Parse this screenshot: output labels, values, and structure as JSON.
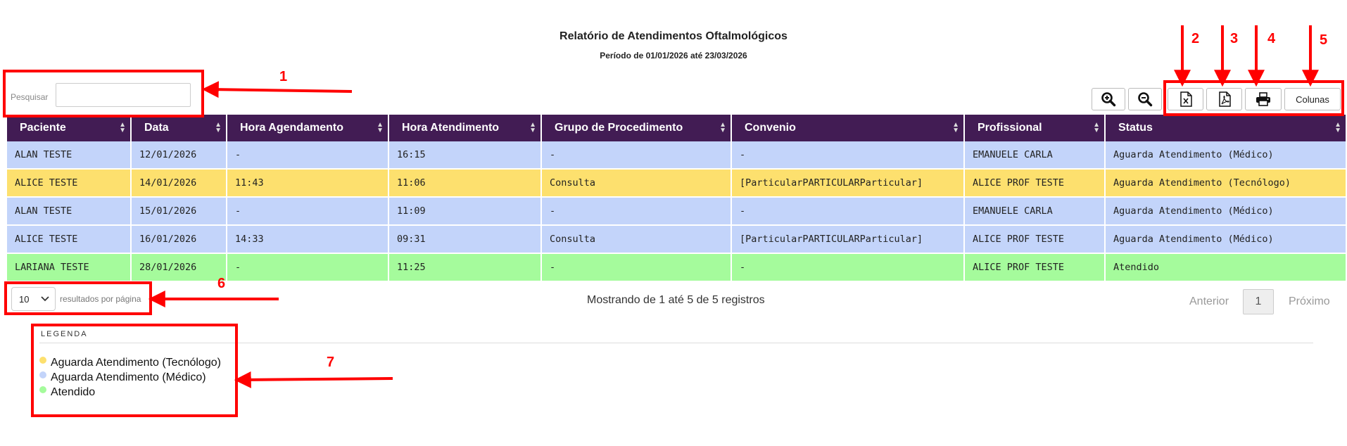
{
  "header": {
    "title": "Relatório de Atendimentos Oftalmológicos",
    "subtitle": "Período de 01/01/2026 até 23/03/2026"
  },
  "search": {
    "label": "Pesquisar",
    "value": ""
  },
  "toolbar": {
    "zoom_in_icon": "zoom-in-icon",
    "zoom_out_icon": "zoom-out-icon",
    "excel_icon": "excel-file-icon",
    "pdf_icon": "pdf-file-icon",
    "print_icon": "printer-icon",
    "columns_label": "Colunas"
  },
  "table": {
    "columns": [
      "Paciente",
      "Data",
      "Hora Agendamento",
      "Hora Atendimento",
      "Grupo de Procedimento",
      "Convenio",
      "Profissional",
      "Status"
    ],
    "rows": [
      {
        "color": "blue",
        "cells": [
          "ALAN TESTE",
          "12/01/2026",
          "-",
          "16:15",
          "-",
          "-",
          "EMANUELE CARLA",
          "Aguarda Atendimento (Médico)"
        ]
      },
      {
        "color": "yellow",
        "cells": [
          "ALICE TESTE",
          "14/01/2026",
          "11:43",
          "11:06",
          "Consulta",
          "[ParticularPARTICULARParticular]",
          "ALICE PROF TESTE",
          "Aguarda Atendimento (Tecnólogo)"
        ]
      },
      {
        "color": "blue",
        "cells": [
          "ALAN TESTE",
          "15/01/2026",
          "-",
          "11:09",
          "-",
          "-",
          "EMANUELE CARLA",
          "Aguarda Atendimento (Médico)"
        ]
      },
      {
        "color": "blue",
        "cells": [
          "ALICE TESTE",
          "16/01/2026",
          "14:33",
          "09:31",
          "Consulta",
          "[ParticularPARTICULARParticular]",
          "ALICE PROF TESTE",
          "Aguarda Atendimento (Médico)"
        ]
      },
      {
        "color": "green",
        "cells": [
          "LARIANA TESTE",
          "28/01/2026",
          "-",
          "11:25",
          "-",
          "-",
          "ALICE PROF TESTE",
          "Atendido"
        ]
      }
    ]
  },
  "footer": {
    "per_page_value": "10",
    "per_page_label": "resultados por página",
    "info": "Mostrando de 1 até 5 de 5 registros",
    "prev_label": "Anterior",
    "page": "1",
    "next_label": "Próximo"
  },
  "legend": {
    "title": "LEGENDA",
    "items": [
      {
        "label": "Aguarda Atendimento (Tecnólogo)",
        "color": "#fde06e"
      },
      {
        "label": "Aguarda Atendimento (Médico)",
        "color": "#c3d4fa"
      },
      {
        "label": "Atendido",
        "color": "#a5fb9c"
      }
    ]
  },
  "annotations": {
    "labels": [
      "1",
      "2",
      "3",
      "4",
      "5",
      "6",
      "7"
    ],
    "color": "#ff0000"
  },
  "colors": {
    "header_bg": "#421c54",
    "row_blue": "#c3d4fa",
    "row_yellow": "#fde06e",
    "row_green": "#a5fb9c"
  }
}
